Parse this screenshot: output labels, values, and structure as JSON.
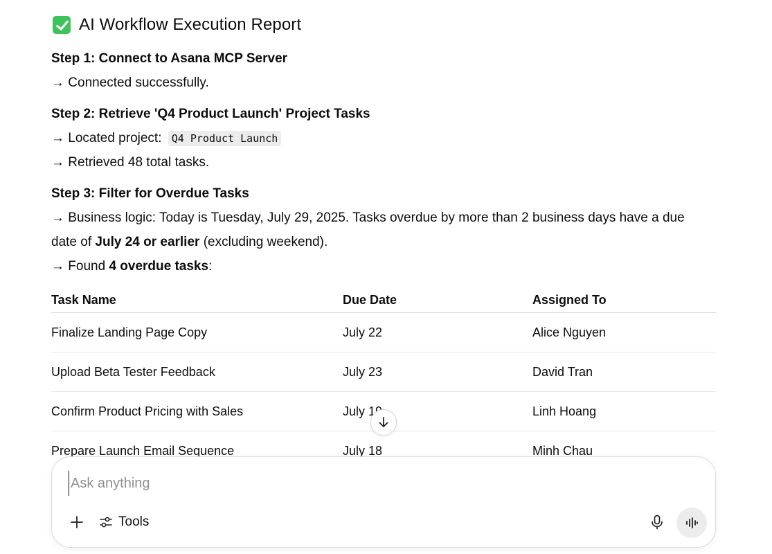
{
  "report": {
    "title": "AI Workflow Execution Report"
  },
  "steps": [
    {
      "heading": "Step 1: Connect to Asana MCP Server",
      "result": "→ Connected successfully."
    },
    {
      "heading": "Step 2: Retrieve 'Q4 Product Launch' Project Tasks",
      "located_prefix": "→ Located project:",
      "project_code": "Q4 Product Launch",
      "retrieved": "→ Retrieved 48 total tasks."
    },
    {
      "heading": "Step 3: Filter for Overdue Tasks",
      "logic_line1": "→ Business logic: Today is Tuesday, July 29, 2025. Tasks overdue by more than 2 business days have a due",
      "logic_line2_prefix": "date of ",
      "logic_line2_bold": "July 24 or earlier",
      "logic_line2_suffix": " (excluding weekend).",
      "found_prefix": "→ Found ",
      "found_bold": "4 overdue tasks",
      "found_suffix": ":"
    }
  ],
  "table": {
    "headers": [
      "Task Name",
      "Due Date",
      "Assigned To"
    ],
    "rows": [
      [
        "Finalize Landing Page Copy",
        "July 22",
        "Alice Nguyen"
      ],
      [
        "Upload Beta Tester Feedback",
        "July 23",
        "David Tran"
      ],
      [
        "Confirm Product Pricing with Sales",
        "July 19",
        "Linh Hoang"
      ],
      [
        "Prepare Launch Email Sequence",
        "July 18",
        "Minh Chau"
      ]
    ]
  },
  "composer": {
    "placeholder": "Ask anything",
    "tools_label": "Tools"
  },
  "icons": {
    "title": "check-mark-icon",
    "scroll": "arrow-down-icon",
    "plus": "plus-icon",
    "tools": "sliders-icon",
    "mic": "microphone-icon",
    "voice": "voice-waveform-icon"
  },
  "colors": {
    "check_green": "#3ec25c",
    "code_bg": "#ececec",
    "voice_button_bg": "#ececec"
  }
}
